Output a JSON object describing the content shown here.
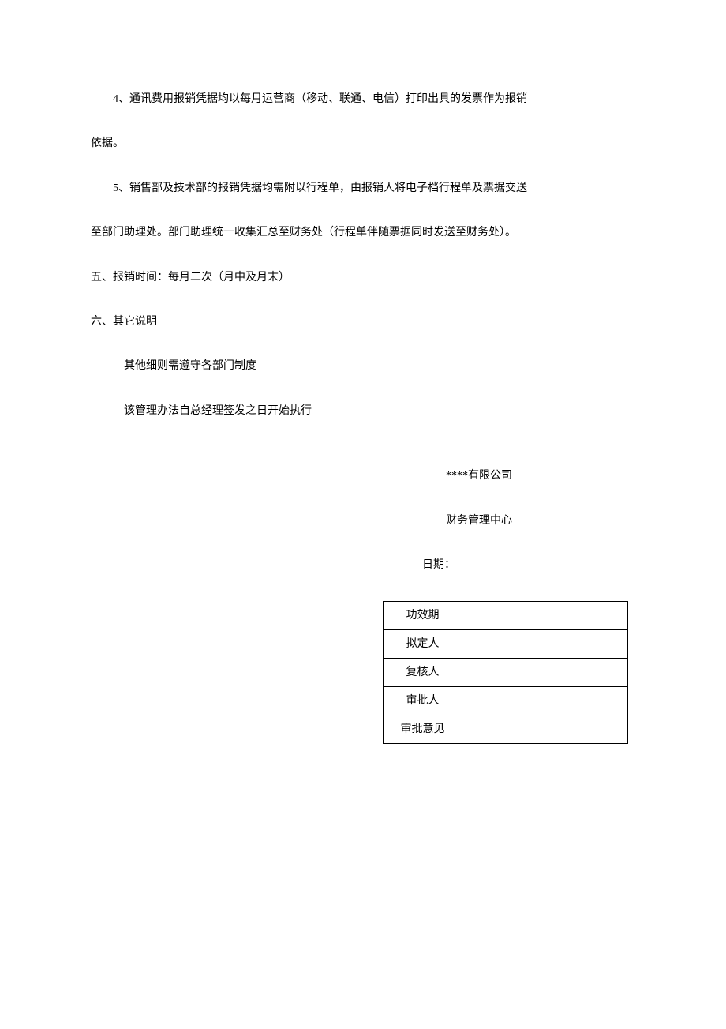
{
  "paragraphs": {
    "p4": "4、通讯费用报销凭据均以每月运营商（移动、联通、电信）打印出具的发票作为报销",
    "p4_cont": "依据。",
    "p5": "5、销售部及技术部的报销凭据均需附以行程单，由报销人将电子档行程单及票据交送",
    "p5_cont": "至部门助理处。部门助理统一收集汇总至财务处（行程单伴随票据同时发送至财务处）。",
    "section5": "五、报销时间：每月二次（月中及月末）",
    "section6": "六、其它说明",
    "sub1": "其他细则需遵守各部门制度",
    "sub2": "该管理办法自总经理签发之日开始执行"
  },
  "signature": {
    "company": "****有限公司",
    "dept": "财务管理中心",
    "date_label": "日期："
  },
  "approval_table": {
    "rows": [
      {
        "label": "功效期",
        "value": ""
      },
      {
        "label": "拟定人",
        "value": ""
      },
      {
        "label": "复核人",
        "value": ""
      },
      {
        "label": "审批人",
        "value": ""
      },
      {
        "label": "审批意见",
        "value": ""
      }
    ]
  }
}
